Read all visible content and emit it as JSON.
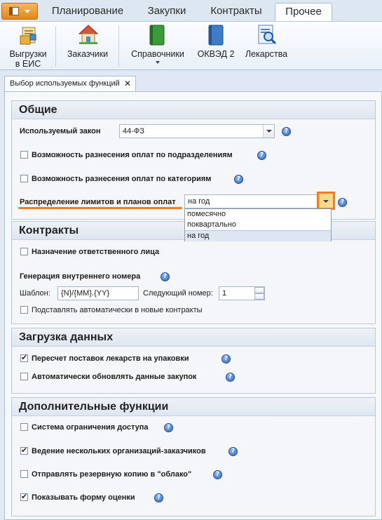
{
  "top_tabs": [
    "Планирование",
    "Закупки",
    "Контракты",
    "Прочее"
  ],
  "active_top_tab": "Прочее",
  "ribbon": {
    "buttons": [
      {
        "label": "Выгрузки\nв ЕИС",
        "icon": "export-package-icon"
      },
      {
        "label": "Заказчики",
        "icon": "house-icon"
      },
      {
        "label": "Справочники",
        "icon": "book-green-icon",
        "has_dropdown": true
      },
      {
        "label": "ОКВЭД 2",
        "icon": "book-blue-icon"
      },
      {
        "label": "Лекарства",
        "icon": "magnifier-document-icon"
      }
    ]
  },
  "doc_tab": {
    "title": "Выбор используемых функций",
    "close": "✕"
  },
  "sections": {
    "general": {
      "title": "Общие",
      "law_label": "Используемый закон",
      "law_value": "44-ФЗ",
      "opt1": "Возможность разнесения оплат по подразделениям",
      "opt2": "Возможность разнесения оплат по категориям",
      "distribution_label": "Распределение лимитов и планов оплат",
      "distribution_value": "на год",
      "distribution_options": [
        "помесячно",
        "поквартально",
        "на год"
      ]
    },
    "contracts": {
      "title": "Контракты",
      "assign_label": "Назначение ответственного лица",
      "gen_label": "Генерация внутреннего номера",
      "template_label": "Шаблон:",
      "template_value": "{N}/{MM}.{YY}",
      "next_label": "Следующий номер:",
      "next_value": "1",
      "auto_label": "Подставлять автоматически в новые контракты"
    },
    "load": {
      "title": "Загрузка данных",
      "opt1": "Пересчет поставок лекарств на упаковки",
      "opt1_checked": true,
      "opt2": "Автоматически обновлять данные закупок",
      "opt2_checked": false
    },
    "extra": {
      "title": "Дополнительные функции",
      "opt1": "Система ограничения доступа",
      "opt1_checked": false,
      "opt2": "Ведение нескольких организаций-заказчиков",
      "opt2_checked": true,
      "opt3": "Отправлять резервную копию в \"облако\"",
      "opt3_checked": false,
      "opt4": "Показывать форму оценки",
      "opt4_checked": true
    }
  },
  "help_glyph": "?",
  "colors": {
    "highlight": "#f47b20",
    "accent": "#2f64c3"
  }
}
